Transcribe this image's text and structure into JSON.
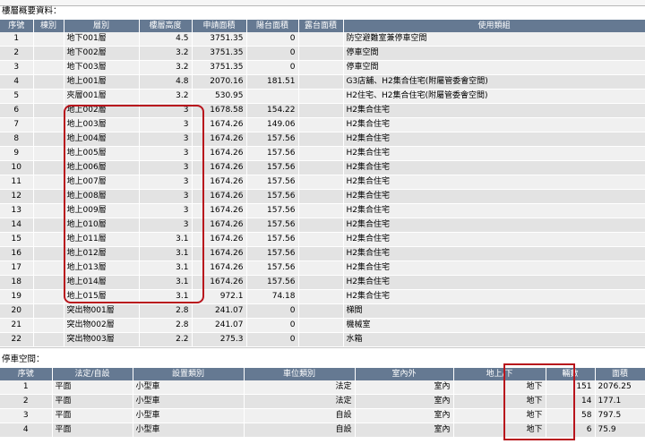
{
  "floors_title": "樓層概要資料：",
  "floor_headers": [
    "序號",
    "棟別",
    "層別",
    "樓層高度",
    "申請面積",
    "陽台面積",
    "露台面積",
    "使用類組"
  ],
  "floors": [
    {
      "no": "1",
      "bldg": "",
      "floor": "地下001層",
      "height": "4.5",
      "area": "3751.35",
      "balcony": "0",
      "terrace": "",
      "use": "防空避難室兼停車空間"
    },
    {
      "no": "2",
      "bldg": "",
      "floor": "地下002層",
      "height": "3.2",
      "area": "3751.35",
      "balcony": "0",
      "terrace": "",
      "use": "停車空間"
    },
    {
      "no": "3",
      "bldg": "",
      "floor": "地下003層",
      "height": "3.2",
      "area": "3751.35",
      "balcony": "0",
      "terrace": "",
      "use": "停車空間"
    },
    {
      "no": "4",
      "bldg": "",
      "floor": "地上001層",
      "height": "4.8",
      "area": "2070.16",
      "balcony": "181.51",
      "terrace": "",
      "use": "G3店舖、H2集合住宅(附屬管委會空間)"
    },
    {
      "no": "5",
      "bldg": "",
      "floor": "夾層001層",
      "height": "3.2",
      "area": "530.95",
      "balcony": "",
      "terrace": "",
      "use": "H2住宅、H2集合住宅(附屬管委會空間)"
    },
    {
      "no": "6",
      "bldg": "",
      "floor": "地上002層",
      "height": "3",
      "area": "1678.58",
      "balcony": "154.22",
      "terrace": "",
      "use": "H2集合住宅"
    },
    {
      "no": "7",
      "bldg": "",
      "floor": "地上003層",
      "height": "3",
      "area": "1674.26",
      "balcony": "149.06",
      "terrace": "",
      "use": "H2集合住宅"
    },
    {
      "no": "8",
      "bldg": "",
      "floor": "地上004層",
      "height": "3",
      "area": "1674.26",
      "balcony": "157.56",
      "terrace": "",
      "use": "H2集合住宅"
    },
    {
      "no": "9",
      "bldg": "",
      "floor": "地上005層",
      "height": "3",
      "area": "1674.26",
      "balcony": "157.56",
      "terrace": "",
      "use": "H2集合住宅"
    },
    {
      "no": "10",
      "bldg": "",
      "floor": "地上006層",
      "height": "3",
      "area": "1674.26",
      "balcony": "157.56",
      "terrace": "",
      "use": "H2集合住宅"
    },
    {
      "no": "11",
      "bldg": "",
      "floor": "地上007層",
      "height": "3",
      "area": "1674.26",
      "balcony": "157.56",
      "terrace": "",
      "use": "H2集合住宅"
    },
    {
      "no": "12",
      "bldg": "",
      "floor": "地上008層",
      "height": "3",
      "area": "1674.26",
      "balcony": "157.56",
      "terrace": "",
      "use": "H2集合住宅"
    },
    {
      "no": "13",
      "bldg": "",
      "floor": "地上009層",
      "height": "3",
      "area": "1674.26",
      "balcony": "157.56",
      "terrace": "",
      "use": "H2集合住宅"
    },
    {
      "no": "14",
      "bldg": "",
      "floor": "地上010層",
      "height": "3",
      "area": "1674.26",
      "balcony": "157.56",
      "terrace": "",
      "use": "H2集合住宅"
    },
    {
      "no": "15",
      "bldg": "",
      "floor": "地上011層",
      "height": "3.1",
      "area": "1674.26",
      "balcony": "157.56",
      "terrace": "",
      "use": "H2集合住宅"
    },
    {
      "no": "16",
      "bldg": "",
      "floor": "地上012層",
      "height": "3.1",
      "area": "1674.26",
      "balcony": "157.56",
      "terrace": "",
      "use": "H2集合住宅"
    },
    {
      "no": "17",
      "bldg": "",
      "floor": "地上013層",
      "height": "3.1",
      "area": "1674.26",
      "balcony": "157.56",
      "terrace": "",
      "use": "H2集合住宅"
    },
    {
      "no": "18",
      "bldg": "",
      "floor": "地上014層",
      "height": "3.1",
      "area": "1674.26",
      "balcony": "157.56",
      "terrace": "",
      "use": "H2集合住宅"
    },
    {
      "no": "19",
      "bldg": "",
      "floor": "地上015層",
      "height": "3.1",
      "area": "972.1",
      "balcony": "74.18",
      "terrace": "",
      "use": "H2集合住宅"
    },
    {
      "no": "20",
      "bldg": "",
      "floor": "突出物001層",
      "height": "2.8",
      "area": "241.07",
      "balcony": "0",
      "terrace": "",
      "use": "梯間"
    },
    {
      "no": "21",
      "bldg": "",
      "floor": "突出物002層",
      "height": "2.8",
      "area": "241.07",
      "balcony": "0",
      "terrace": "",
      "use": "機械室"
    },
    {
      "no": "22",
      "bldg": "",
      "floor": "突出物003層",
      "height": "2.2",
      "area": "275.3",
      "balcony": "0",
      "terrace": "",
      "use": "水箱"
    }
  ],
  "parking_title": "停車空間：",
  "parking_headers": [
    "序號",
    "法定/自設",
    "設置類別",
    "車位類別",
    "室內外",
    "地上/下",
    "輛數",
    "面積"
  ],
  "parking": [
    {
      "no": "1",
      "legal": "平面",
      "kind": "小型車",
      "cat": "法定",
      "inout": "室內",
      "level": "地下",
      "count": "151",
      "area": "2076.25"
    },
    {
      "no": "2",
      "legal": "平面",
      "kind": "小型車",
      "cat": "法定",
      "inout": "室內",
      "level": "地下",
      "count": "14",
      "area": "177.1"
    },
    {
      "no": "3",
      "legal": "平面",
      "kind": "小型車",
      "cat": "自設",
      "inout": "室內",
      "level": "地下",
      "count": "58",
      "area": "797.5"
    },
    {
      "no": "4",
      "legal": "平面",
      "kind": "小型車",
      "cat": "自設",
      "inout": "室內",
      "level": "地下",
      "count": "6",
      "area": "75.9"
    }
  ],
  "colors": {
    "header_bg": "#657992",
    "highlight": "#b8141c"
  }
}
